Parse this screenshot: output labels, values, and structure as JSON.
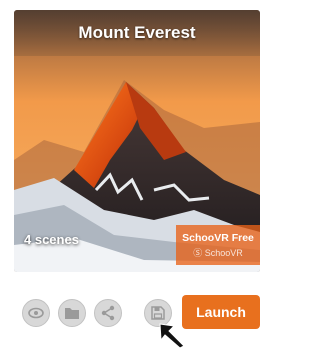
{
  "card": {
    "title": "Mount Everest",
    "scenes": "4 scenes",
    "badge_plan": "SchooVR Free",
    "badge_brand": "Ⓢ SchooVR"
  },
  "actions": {
    "launch_label": "Launch",
    "icons": [
      "eye-icon",
      "folder-icon",
      "share-icon",
      "save-icon"
    ]
  },
  "colors": {
    "accent": "#e8701e",
    "icon_button_bg": "#d8d8d8",
    "icon_glyph": "#9a9a9a"
  }
}
